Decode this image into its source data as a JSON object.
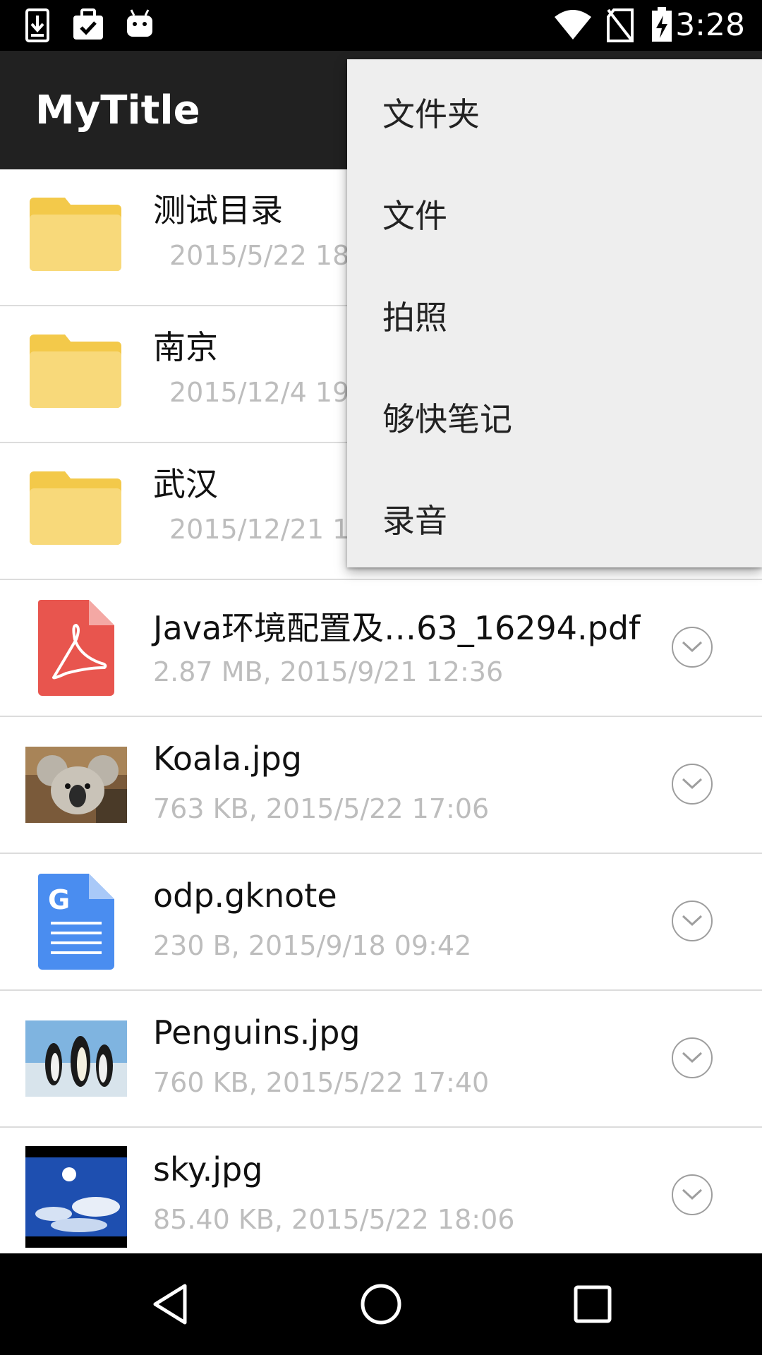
{
  "status_bar": {
    "time": "3:28",
    "icons": [
      "download-icon",
      "briefcase-check-icon",
      "android-icon",
      "wifi-icon",
      "no-sim-icon",
      "battery-charging-icon"
    ]
  },
  "app_bar": {
    "title": "MyTitle"
  },
  "menu": {
    "items": [
      {
        "label": "文件夹"
      },
      {
        "label": "文件"
      },
      {
        "label": "拍照"
      },
      {
        "label": "够快笔记"
      },
      {
        "label": "录音"
      }
    ]
  },
  "files": [
    {
      "name": "测试目录",
      "meta": "2015/5/22 18",
      "icon": "folder-icon"
    },
    {
      "name": "南京",
      "meta": "2015/12/4 19",
      "icon": "folder-icon"
    },
    {
      "name": "武汉",
      "meta": "2015/12/21 1",
      "icon": "folder-icon"
    },
    {
      "name": "Java环境配置及…63_16294.pdf",
      "meta": "2.87 MB, 2015/9/21 12:36",
      "icon": "pdf-icon"
    },
    {
      "name": "Koala.jpg",
      "meta": "763 KB, 2015/5/22 17:06",
      "icon": "koala-thumbnail"
    },
    {
      "name": "odp.gknote",
      "meta": "230 B, 2015/9/18 09:42",
      "icon": "gknote-doc-icon"
    },
    {
      "name": "Penguins.jpg",
      "meta": "760 KB, 2015/5/22 17:40",
      "icon": "penguins-thumbnail"
    },
    {
      "name": "sky.jpg",
      "meta": "85.40 KB, 2015/5/22 18:06",
      "icon": "sky-thumbnail"
    }
  ],
  "nav_bar": {
    "buttons": [
      "back-icon",
      "home-icon",
      "recents-icon"
    ]
  },
  "colors": {
    "app_bar": "#212121",
    "menu_bg": "#eeeeee",
    "folder": "#f8d874",
    "pdf": "#e8554e",
    "doc": "#4a8df0",
    "meta_text": "#bdbdbd"
  }
}
